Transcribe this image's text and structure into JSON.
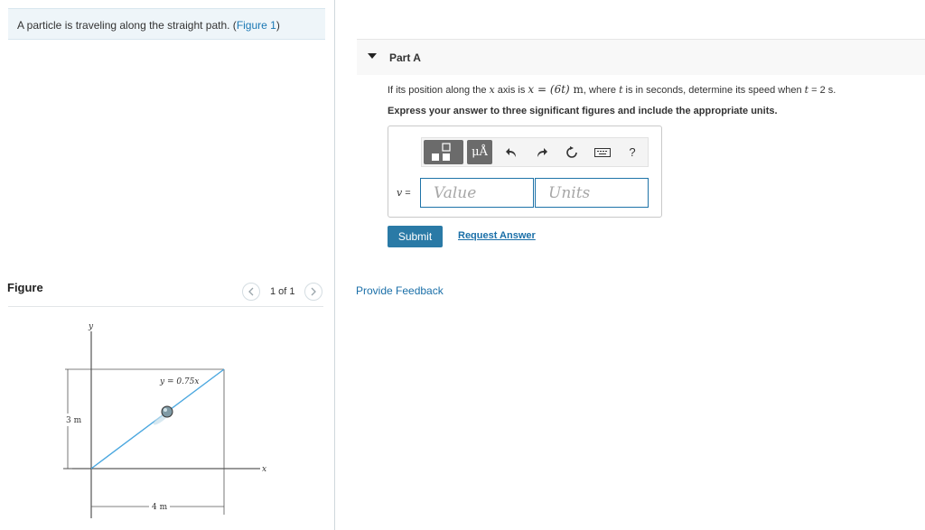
{
  "intro": {
    "text": "A particle is traveling along the straight path. (",
    "figure_link": "Figure 1",
    "close": ")"
  },
  "figure_panel": {
    "heading": "Figure",
    "pager": "1 of 1",
    "diagram": {
      "y_axis_label": "y",
      "x_axis_label": "x",
      "line_label": "y = 0.75x",
      "height_dim": "3 m",
      "width_dim": "4 m"
    }
  },
  "part": {
    "title": "Part A",
    "question": {
      "pre": "If its position along the ",
      "var_x": "x",
      "mid": " axis is ",
      "eq_lhs": "x",
      "eq_sign": " = ",
      "eq_rhs": "(6t)",
      "unit": " m",
      "post1": ", where ",
      "var_t": "t",
      "post2": " is in seconds, determine its speed when ",
      "var_t2": "t",
      "tail": " = 2 s."
    },
    "instruction": "Express your answer to three significant figures and include the appropriate units.",
    "toolbar": {
      "units_label": "μÅ",
      "help_label": "?"
    },
    "answer": {
      "var_label": "v",
      "eq": " =",
      "value_placeholder": "Value",
      "units_placeholder": "Units"
    },
    "submit_label": "Submit",
    "request_answer_label": "Request Answer"
  },
  "feedback_label": "Provide Feedback",
  "colors": {
    "accent": "#2a7aa6",
    "link": "#1a6fa8",
    "path_line": "#4aa7df"
  }
}
